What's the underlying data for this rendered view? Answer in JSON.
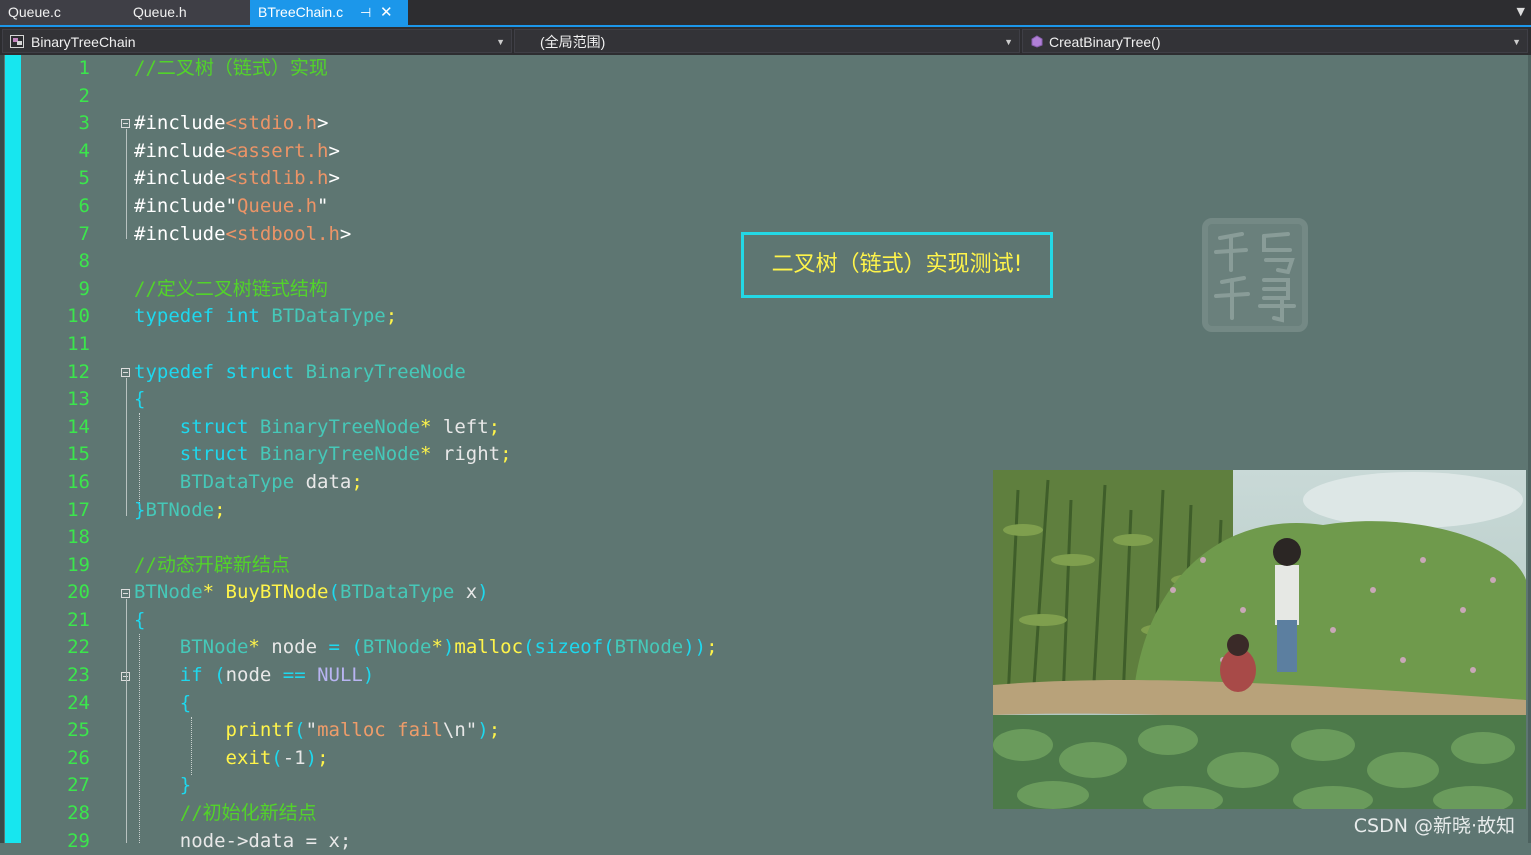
{
  "tabs": [
    {
      "label": "Queue.c",
      "active": false
    },
    {
      "label": "Queue.h",
      "active": false
    },
    {
      "label": "BTreeChain.c",
      "active": true
    }
  ],
  "tab_pin_glyph": "⊣",
  "tab_close_glyph": "✕",
  "navbar": {
    "project": "BinaryTreeChain",
    "scope": "(全局范围)",
    "member": "CreatBinaryTree()"
  },
  "line_numbers": [
    "1",
    "2",
    "3",
    "4",
    "5",
    "6",
    "7",
    "8",
    "9",
    "10",
    "11",
    "12",
    "13",
    "14",
    "15",
    "16",
    "17",
    "18",
    "19",
    "20",
    "21",
    "22",
    "23",
    "24",
    "25",
    "26",
    "27",
    "28",
    "29"
  ],
  "code_lines": [
    [
      [
        "cmt",
        "//二叉树（链式）实现"
      ]
    ],
    [],
    [
      [
        "inc",
        "#include"
      ],
      [
        "hdr",
        "<stdio.h"
      ],
      [
        "inc",
        ">"
      ]
    ],
    [
      [
        "inc",
        "#include"
      ],
      [
        "hdr",
        "<assert.h"
      ],
      [
        "inc",
        ">"
      ]
    ],
    [
      [
        "inc",
        "#include"
      ],
      [
        "hdr",
        "<stdlib.h"
      ],
      [
        "inc",
        ">"
      ]
    ],
    [
      [
        "inc",
        "#include\""
      ],
      [
        "hdr",
        "Queue.h"
      ],
      [
        "inc",
        "\""
      ]
    ],
    [
      [
        "inc",
        "#include"
      ],
      [
        "hdr",
        "<stdbool.h"
      ],
      [
        "inc",
        ">"
      ]
    ],
    [],
    [
      [
        "cmt",
        "//定义二叉树链式结构"
      ]
    ],
    [
      [
        "kw",
        "typedef"
      ],
      [
        "pun",
        " "
      ],
      [
        "kw",
        "int"
      ],
      [
        "pun",
        " "
      ],
      [
        "typ",
        "BTDataType"
      ],
      [
        "fn",
        ";"
      ]
    ],
    [],
    [
      [
        "kw",
        "typedef"
      ],
      [
        "pun",
        " "
      ],
      [
        "kw",
        "struct"
      ],
      [
        "pun",
        " "
      ],
      [
        "typ",
        "BinaryTreeNode"
      ]
    ],
    [
      [
        "kw",
        "{"
      ]
    ],
    [
      [
        "pun",
        "    "
      ],
      [
        "kw",
        "struct"
      ],
      [
        "pun",
        " "
      ],
      [
        "typ",
        "BinaryTreeNode"
      ],
      [
        "fn",
        "*"
      ],
      [
        "pun",
        " left"
      ],
      [
        "fn",
        ";"
      ]
    ],
    [
      [
        "pun",
        "    "
      ],
      [
        "kw",
        "struct"
      ],
      [
        "pun",
        " "
      ],
      [
        "typ",
        "BinaryTreeNode"
      ],
      [
        "fn",
        "*"
      ],
      [
        "pun",
        " right"
      ],
      [
        "fn",
        ";"
      ]
    ],
    [
      [
        "pun",
        "    "
      ],
      [
        "typ",
        "BTDataType"
      ],
      [
        "pun",
        " data"
      ],
      [
        "fn",
        ";"
      ]
    ],
    [
      [
        "kw",
        "}"
      ],
      [
        "typ",
        "BTNode"
      ],
      [
        "fn",
        ";"
      ]
    ],
    [],
    [
      [
        "cmt",
        "//动态开辟新结点"
      ]
    ],
    [
      [
        "typ",
        "BTNode"
      ],
      [
        "fn",
        "*"
      ],
      [
        "pun",
        " "
      ],
      [
        "fn",
        "BuyBTNode"
      ],
      [
        "kw",
        "("
      ],
      [
        "typ",
        "BTDataType"
      ],
      [
        "pun",
        " x"
      ],
      [
        "kw",
        ")"
      ]
    ],
    [
      [
        "kw",
        "{"
      ]
    ],
    [
      [
        "pun",
        "    "
      ],
      [
        "typ",
        "BTNode"
      ],
      [
        "fn",
        "*"
      ],
      [
        "pun",
        " node "
      ],
      [
        "kw",
        "="
      ],
      [
        "pun",
        " "
      ],
      [
        "kw",
        "("
      ],
      [
        "typ",
        "BTNode"
      ],
      [
        "fn",
        "*"
      ],
      [
        "kw",
        ")"
      ],
      [
        "fn",
        "malloc"
      ],
      [
        "kw",
        "("
      ],
      [
        "kw",
        "sizeof"
      ],
      [
        "kw",
        "("
      ],
      [
        "typ",
        "BTNode"
      ],
      [
        "kw",
        "))"
      ],
      [
        "fn",
        ";"
      ]
    ],
    [
      [
        "pun",
        "    "
      ],
      [
        "kw",
        "if"
      ],
      [
        "pun",
        " "
      ],
      [
        "kw",
        "("
      ],
      [
        "pun",
        "node "
      ],
      [
        "kw",
        "=="
      ],
      [
        "pun",
        " "
      ],
      [
        "mac",
        "NULL"
      ],
      [
        "kw",
        ")"
      ]
    ],
    [
      [
        "pun",
        "    "
      ],
      [
        "kw",
        "{"
      ]
    ],
    [
      [
        "pun",
        "        "
      ],
      [
        "fn",
        "printf"
      ],
      [
        "kw",
        "("
      ],
      [
        "pun",
        "\""
      ],
      [
        "str",
        "malloc fail"
      ],
      [
        "pun",
        "\\n\""
      ],
      [
        "kw",
        ")"
      ],
      [
        "fn",
        ";"
      ]
    ],
    [
      [
        "pun",
        "        "
      ],
      [
        "fn",
        "exit"
      ],
      [
        "kw",
        "("
      ],
      [
        "pun",
        "-1"
      ],
      [
        "kw",
        ")"
      ],
      [
        "fn",
        ";"
      ]
    ],
    [
      [
        "pun",
        "    "
      ],
      [
        "kw",
        "}"
      ]
    ],
    [
      [
        "pun",
        "    "
      ],
      [
        "cmt",
        "//初始化新结点"
      ]
    ],
    [
      [
        "pun",
        "    node->data = x;"
      ]
    ]
  ],
  "callout_text": "二叉树（链式）实现测试!",
  "seal_text": "千与千寻",
  "watermark": "CSDN @新晓·故知",
  "colors": {
    "editor_bg": "#5e7672",
    "line_number": "#3be64c",
    "keyword": "#1ed8ee",
    "type": "#46c8b8",
    "function": "#fff44a",
    "comment": "#52d32a",
    "accent": "#1c97ea"
  }
}
